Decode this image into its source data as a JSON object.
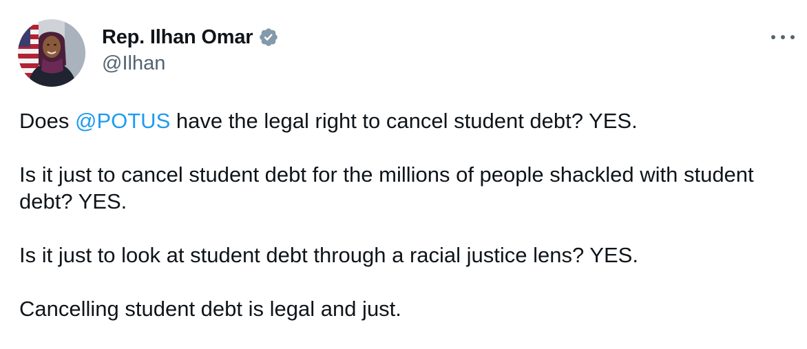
{
  "author": {
    "display_name": "Rep. Ilhan Omar",
    "handle": "@Ilhan",
    "verified_icon": "verified-badge-icon",
    "avatar_icon": "profile-photo"
  },
  "menu": {
    "icon": "more-options-icon"
  },
  "tweet": {
    "p1_before": "Does ",
    "p1_mention": "@POTUS",
    "p1_after": " have the legal right to cancel student debt? YES.",
    "p2": "Is it just to cancel student debt for the millions of people shackled with student debt? YES.",
    "p3": "Is it just to look at student debt through a racial justice lens? YES.",
    "p4": "Cancelling student debt is legal and just."
  },
  "colors": {
    "text": "#0f1419",
    "secondary": "#536471",
    "link": "#1d9bf0",
    "verified_badge": "#829aab"
  }
}
